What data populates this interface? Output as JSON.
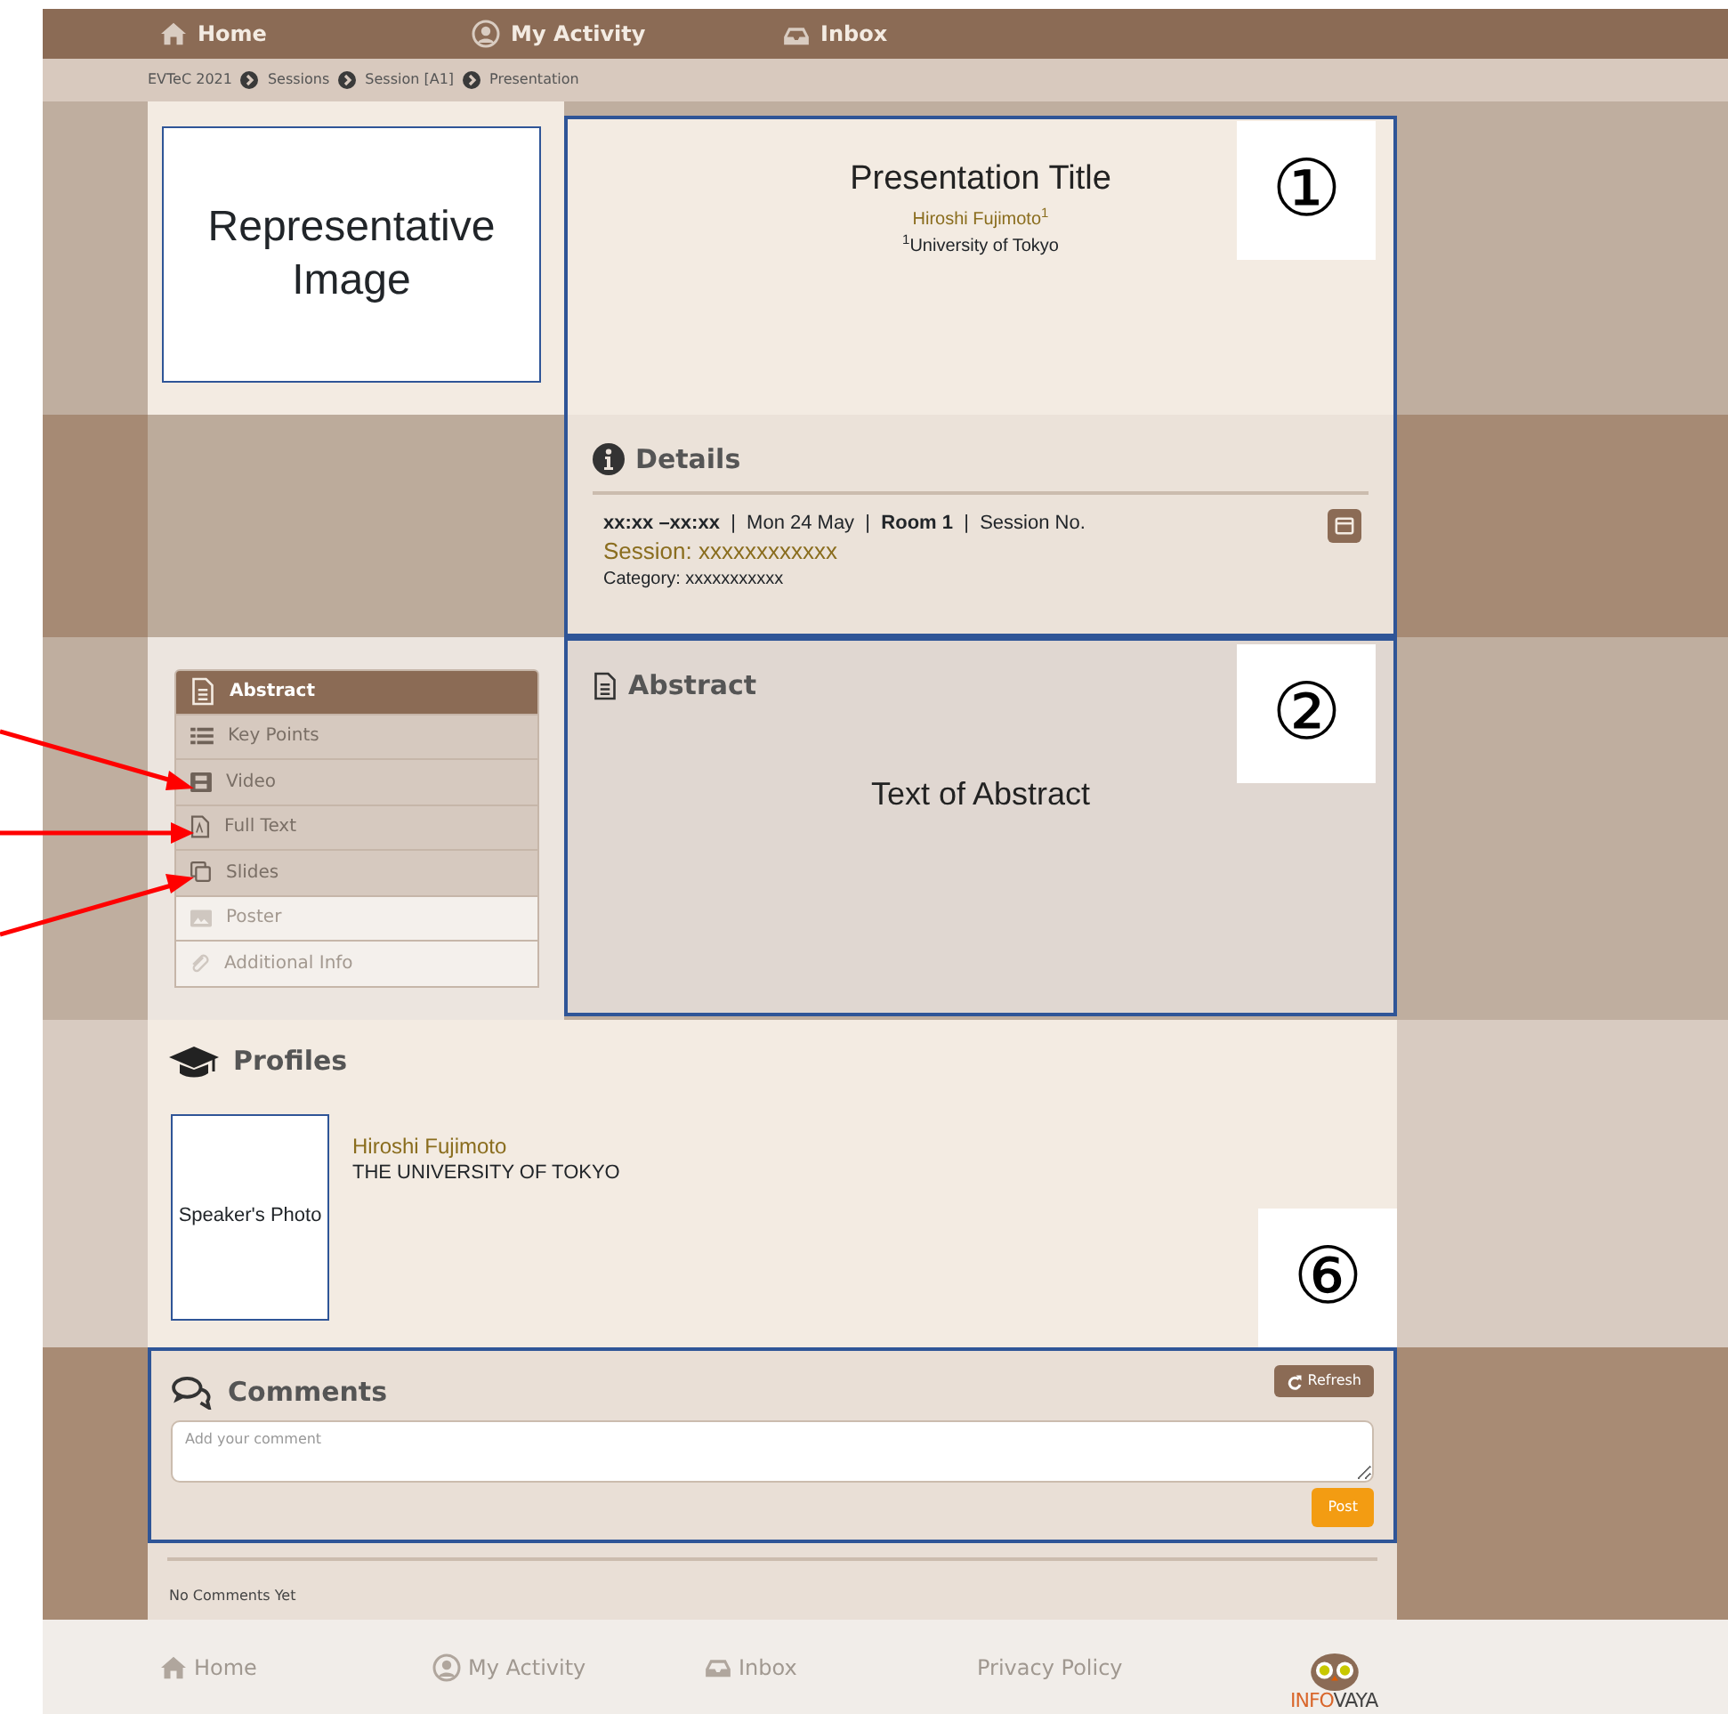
{
  "top_nav": [
    {
      "label": "Home"
    },
    {
      "label": "My Activity"
    },
    {
      "label": "Inbox"
    }
  ],
  "breadcrumb": [
    "EVTeC 2021",
    "Sessions",
    "Session [A1]",
    "Presentation"
  ],
  "image_placeholder": "Representative Image",
  "presentation": {
    "title": "Presentation Title",
    "author": "Hiroshi Fujimoto$^{1}$",
    "affiliation": "$^{1}$University of Tokyo",
    "marker": "①"
  },
  "details": {
    "heading": "Details",
    "schedule": "**xx:xx –xx:xx**  |  Mon 24 May  |  **Room 1**  |  Session No.",
    "session": "Session: xxxxxxxxxxxx",
    "category": "Category: xxxxxxxxxxx"
  },
  "tabs": [
    {
      "label": "Abstract",
      "selected": true,
      "disabled": false
    },
    {
      "label": "Key Points",
      "selected": false,
      "disabled": false
    },
    {
      "label": "Video",
      "selected": false,
      "disabled": false
    },
    {
      "label": "Full Text",
      "selected": false,
      "disabled": false
    },
    {
      "label": "Slides",
      "selected": false,
      "disabled": false
    },
    {
      "label": "Poster",
      "selected": false,
      "disabled": true
    },
    {
      "label": "Additional Info",
      "selected": false,
      "disabled": true
    }
  ],
  "abstract": {
    "heading": "Abstract",
    "text": "Text of Abstract",
    "marker": "②"
  },
  "profiles": {
    "heading": "Profiles",
    "photo_placeholder": "Speaker's Photo",
    "name": "Hiroshi Fujimoto",
    "affiliation": "THE UNIVERSITY OF TOKYO",
    "marker": "⑥"
  },
  "comments": {
    "heading": "Comments",
    "refresh": "Refresh",
    "placeholder": "Add your comment",
    "post": "Post",
    "empty": "No Comments Yet"
  },
  "footer": {
    "links": [
      "Home",
      "My Activity",
      "Inbox",
      "Privacy Policy"
    ],
    "logo": [
      "INFO",
      "VAYA"
    ]
  }
}
